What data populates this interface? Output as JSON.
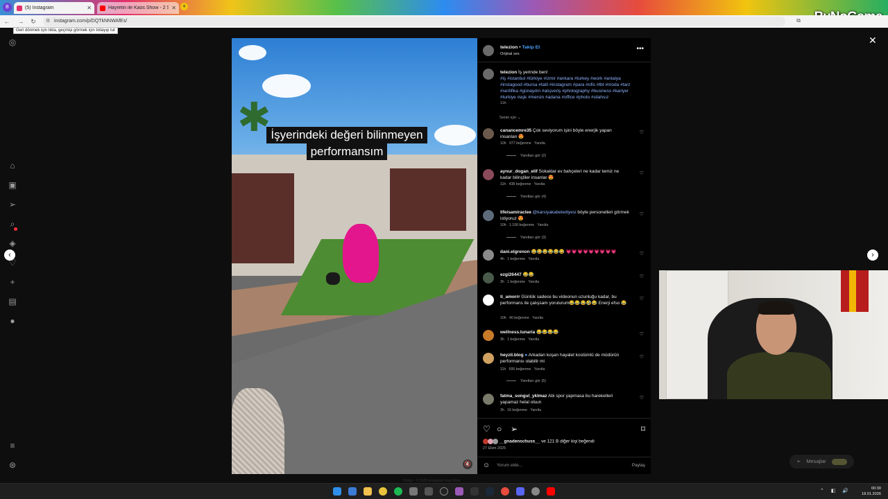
{
  "browser": {
    "tabs": [
      {
        "title": "(5) Instagram",
        "active": true,
        "favicon_color": "#e1306c"
      },
      {
        "title": "Hayretin ile Kaos Show - 2 Sa...",
        "active": false,
        "favicon_color": "#ff0000"
      }
    ],
    "new_tab_glyph": "+",
    "url": "instagram.com/p/DQTkNNWAfEs/",
    "tooltip": "Geri dönmek için tıkla, geçmişi görmek için tıklayıp tut",
    "profile_initial": "B"
  },
  "stream_logo": "ByNoGame",
  "post": {
    "author": "telezion",
    "follow_label": "Takip Et",
    "audio": "Orijinal ses",
    "caption_text": "İş yerinde ben!",
    "hashtags": "#iş #istanbul #türkiye #izmir #ankara #turkey #work #antalya #instagood #bursa #tatil #instagram #para #ofis #tbt #moda #tarz #sertifika #günaydın #alışveriş #photography #business #kariyer #turkiye #aşk #mersin #adana #office #photo #silahsız",
    "caption_age": "11h",
    "sort_label": "Senin için",
    "video_caption_line1": "İşyerindeki değeri bilinmeyen",
    "video_caption_line2": "performansım",
    "likes_user": "__gnadenschuss__",
    "likes_text": "ve 121 B diğer kişi beğendi",
    "date": "27 Ekim 2025",
    "add_comment_placeholder": "Yorum ekle...",
    "post_label": "Paylaş"
  },
  "comments": [
    {
      "user": "canancemre35",
      "text": "Çok seviyorum işini böyle enerjik yapan insanları 😍",
      "age": "10h",
      "likes": "977 beğenme",
      "reply": "Yanıtla",
      "replies": "Yanıtları gör (2)",
      "avatar_color": "#6b5a4c"
    },
    {
      "user": "aynur_dogan_elif",
      "text": "Sokaklar ev bahçeleri ne kadar temiz ne kadar bilinçliler insanlar 😍",
      "age": "11h",
      "likes": "438 beğenme",
      "reply": "Yanıtla",
      "replies": "Yanıtları gör (4)",
      "avatar_color": "#8b4a5a"
    },
    {
      "user": "lifeisamiraclee",
      "mention": "@karsiyakabelediyesi",
      "text": "böyle personelleri görmek istiyoruz 😍",
      "age": "10h",
      "likes": "1.106 beğenme",
      "reply": "Yanıtla",
      "replies": "Yanıtları gör (3)",
      "avatar_color": "#5d6a7a"
    },
    {
      "user": "dani.elgrenon",
      "text": "😂😂😂😂😂😂 💗💗💗💗💗💗💗💗💗",
      "age": "4h",
      "likes": "1 beğenme",
      "reply": "Yanıtla",
      "avatar_color": "#8a8a8a"
    },
    {
      "user": "ezgi26447",
      "text": "😂😂",
      "age": "3h",
      "likes": "1 beğenme",
      "reply": "Yanıtla",
      "avatar_color": "#4a5a4a"
    },
    {
      "user": "ti_amorrr",
      "text": "Günlük sadece bu videonun uzunluğu kadar, bu performans ile çalışsam yorulurum😂😂😂🤣😂 Enerji efso 😂",
      "age": "10h",
      "likes": "40 beğenme",
      "reply": "Yanıtla",
      "avatar_color": "#ffffff"
    },
    {
      "user": "wellness.lunaria",
      "text": "😂😂😂😂",
      "age": "3h",
      "likes": "1 beğenme",
      "reply": "Yanıtla",
      "avatar_color": "#c77a28"
    },
    {
      "user": "heyzil.blog",
      "verified": "●",
      "text": "Arkadan koşan hayalet kostümlü de müdürün performansı olabilir mi",
      "age": "11h",
      "likes": "695 beğenme",
      "reply": "Yanıtla",
      "replies": "Yanıtları gör (5)",
      "avatar_color": "#d0a060"
    },
    {
      "user": "fatma_songul_yklmaz",
      "text": "Abi spor yapmasa bu hareketleri yapamaz helal olsun",
      "age": "3h",
      "likes": "16 beğenme",
      "reply": "Yanıtla",
      "avatar_color": "#7a7a6a"
    }
  ],
  "chat": {
    "label": "Mesajlar"
  },
  "footer_text": "Türkçe  ·  © 2025 Instagram from Meta",
  "taskbar": {
    "time": "00:30",
    "date": "18.01.2026",
    "icons": [
      "windows-start",
      "widgets",
      "file-explorer",
      "chrome",
      "spotify",
      "obs",
      "app",
      "steam",
      "discord",
      "settings",
      "app",
      "app",
      "gear",
      "youtube"
    ]
  }
}
